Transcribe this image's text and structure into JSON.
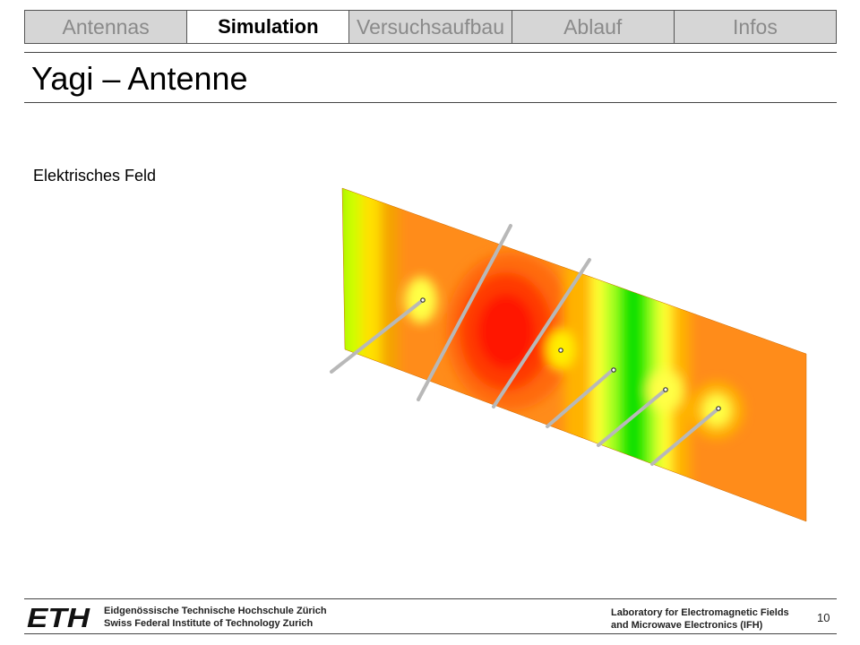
{
  "tabs": [
    {
      "label": "Antennas",
      "active": false
    },
    {
      "label": "Simulation",
      "active": true
    },
    {
      "label": "Versuchsaufbau",
      "active": false
    },
    {
      "label": "Ablauf",
      "active": false
    },
    {
      "label": "Infos",
      "active": false
    }
  ],
  "title": "Yagi – Antenne",
  "subtitle": "Elektrisches Feld",
  "footer": {
    "logo": "ETH",
    "institute_line1": "Eidgenössische Technische Hochschule Zürich",
    "institute_line2": "Swiss Federal Institute of Technology Zurich",
    "lab_line1": "Laboratory for Electromagnetic Fields",
    "lab_line2": "and Microwave Electronics (IFH)",
    "page_number": "10"
  },
  "colors": {
    "tab_bg": "#d6d6d6",
    "tab_inactive_text": "#8a8a8a",
    "field_high": "#ff2a00",
    "field_mid": "#ff8c1a",
    "field_low": "#ffff33",
    "field_min": "#00e600"
  }
}
